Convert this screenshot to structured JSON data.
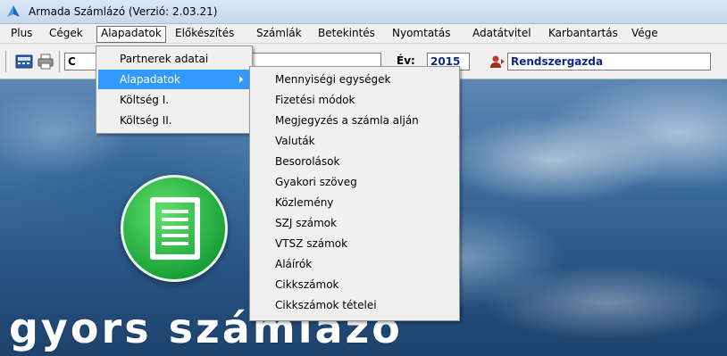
{
  "window": {
    "title": "Armada Számlázó (Verzió: 2.03.21)"
  },
  "menubar": {
    "items": [
      "Plus",
      "Cégek",
      "Alapadatok",
      "Előkészítés",
      "Számlák",
      "Betekintés",
      "Nyomtatás",
      "Adatátvitel",
      "Karbantartás",
      "Vége"
    ],
    "active": "Alapadatok"
  },
  "toolbar": {
    "company_prefix": "C",
    "year_label": "Év:",
    "year_value": "2015",
    "user_value": "Rendszergazda"
  },
  "brand": {
    "text": "gyors számlázó"
  },
  "dropdown": {
    "items": [
      "Partnerek adatai",
      "Alapadatok",
      "Költség I.",
      "Költség II."
    ],
    "highlighted": "Alapadatok"
  },
  "submenu": {
    "items": [
      "Mennyiségi egységek",
      "Fizetési módok",
      "Megjegyzés a számla alján",
      "Valuták",
      "Besorolások",
      "Gyakori szöveg",
      "Közlemény",
      "SZJ számok",
      "VTSZ számok",
      "Aláírók",
      "Cikkszámok",
      "Cikkszámok tételei"
    ]
  },
  "colors": {
    "highlight": "#3399ff",
    "logo_green": "#1ba33a"
  }
}
